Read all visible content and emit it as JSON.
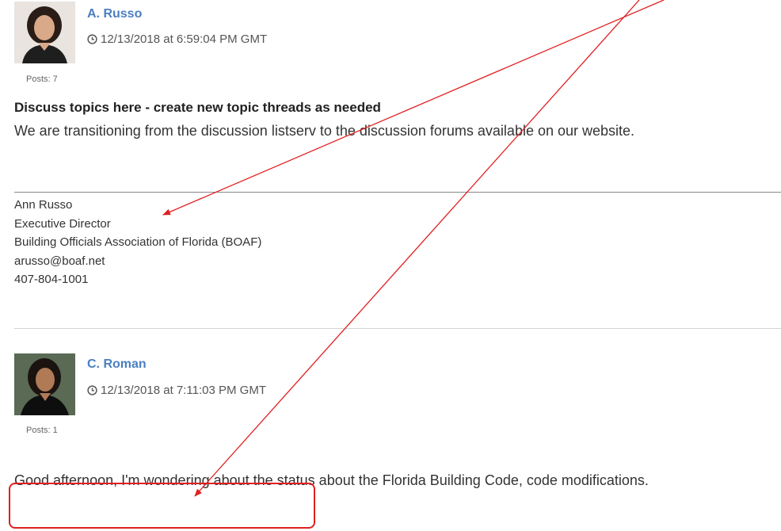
{
  "posts": [
    {
      "author": "A. Russo",
      "timestamp": "12/13/2018 at 6:59:04 PM GMT",
      "posts_count": "Posts: 7",
      "subject": "Discuss topics here - create new topic threads as needed",
      "body": "We are transitioning from the discussion listserv to the discussion forums available on our website.",
      "signature": {
        "name": "Ann Russo",
        "title": "Executive Director",
        "organization": "Building Officials Association of Florida (BOAF)",
        "email": "arusso@boaf.net",
        "phone": "407-804-1001"
      }
    },
    {
      "author": "C. Roman",
      "timestamp": "12/13/2018 at 7:11:03 PM GMT",
      "posts_count": "Posts: 1",
      "body": "Good afternoon, I'm wondering about the status about the Florida Building Code, code modifications."
    }
  ],
  "colors": {
    "author_link": "#4a7fc1",
    "annotation": "#e02020"
  },
  "icons": {
    "timestamp": "clock-icon"
  }
}
